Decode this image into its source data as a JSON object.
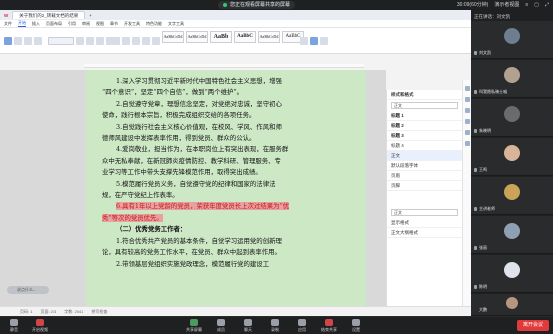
{
  "top": {
    "left_text": "",
    "share_text": "您正在观看屏幕共享的屏幕",
    "time": "30:09(60分钟)",
    "view_btn": "演示者视图",
    "icons": [
      "menu-icon",
      "maximize-icon",
      "fullscreen-icon"
    ]
  },
  "wps": {
    "tab": "关于我们的2_转载文档的结果",
    "menu": [
      "文件",
      "开始",
      "插入",
      "页面布局",
      "引用",
      "审阅",
      "视图",
      "章节",
      "开发工具",
      "特色功能",
      "文字工具"
    ],
    "menu_active": "开始",
    "styles": [
      "AaBbCcDd",
      "AaBbCcDd",
      "AaBb",
      "AaBbC",
      "AaBbCcDd",
      "AaBbC"
    ],
    "paragraphs": [
      {
        "text": "1.深入学习贯彻习近平新时代中国特色社会主义思想，增强"
      },
      {
        "text": "“四个意识”，坚定“四个自信”，做到“两个维护”。"
      },
      {
        "text": "2.自觉遵守党章，理想信念坚定，对党绝对忠诚，坚守初心"
      },
      {
        "text": "使命，践行根本宗旨，积极完成组织交给的各项任务。"
      },
      {
        "text": "3.自觉践行社会主义核心价值观，在校风、学风、作风和师"
      },
      {
        "text": "德师风建设中发挥表率作用，得到党员、群众的公认。"
      },
      {
        "text": "4.爱岗敬业，担当作为，在本职岗位上有突出表现，在服务群"
      },
      {
        "text": "众中无私奉献，在新冠肺炎疫情防控、教学科研、管理服务、专"
      },
      {
        "text": "业学习等工作中带头支撑先锋模范作用，取得突出成绩。"
      },
      {
        "text": "5.模范履行党员义务，自觉遵守党的纪律和国家的法律法"
      },
      {
        "text": "规，在严守党纪上作表率。"
      },
      {
        "text": "6.具有1年以上党龄的党员，荣获年度党员长上次过结果为“优",
        "hl": true
      },
      {
        "text": "秀”等次的党员优先。",
        "hl": true
      },
      {
        "text": "（二）优秀党务工作者：",
        "bold": true
      },
      {
        "text": "1.符合优秀共产党员的基本条件，自觉学习运用党的创新理"
      },
      {
        "text": "论，具有较高的党务工作水平，在党员、群众中起到表率作用。"
      },
      {
        "text": "2.带领基层党组织实施党政理念，模范履行党的建设工"
      }
    ],
    "comment_placeholder": "说点什么...",
    "status": [
      "页码: 1",
      "页面: 2/3",
      "字数: 2041",
      "拼写检查"
    ],
    "pane_title": "样式和格式",
    "pane_field": "正文",
    "pane_items": [
      "标题 1",
      "标题 2",
      "标题 3",
      "标题 4",
      "正文",
      "默认段落字体",
      "页眉",
      "页脚"
    ],
    "pane_field2": "正文",
    "pane_footer1": "显示格式",
    "pane_footer2": "正文大纲格式"
  },
  "right": {
    "speaking": "正在讲话：刘文凯",
    "tiles": [
      {
        "name": "刘文凯"
      },
      {
        "name": "叫我隐私骑士喵"
      },
      {
        "name": "朱晓明"
      },
      {
        "name": "王鸣"
      },
      {
        "name": "主讲老师"
      },
      {
        "name": "张丽"
      },
      {
        "name": "陈明"
      },
      {
        "name": "大鹏"
      }
    ]
  },
  "bottom": {
    "items": [
      "静音",
      "开启视频",
      "共享屏幕",
      "成员",
      "聊天",
      "录制",
      "应用",
      "结束共享",
      "设置"
    ],
    "leave": "离开会议"
  }
}
